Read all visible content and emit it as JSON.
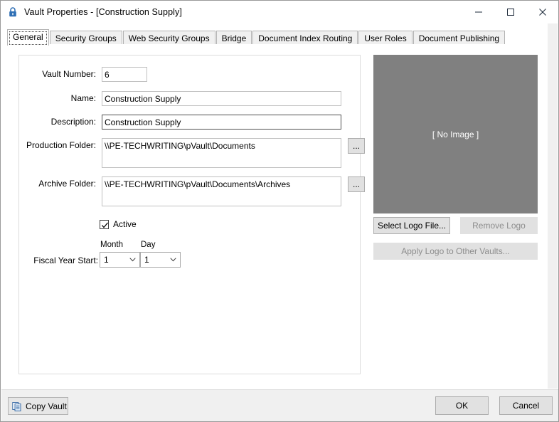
{
  "window": {
    "title": "Vault Properties - [Construction Supply]",
    "icon": "lock-icon",
    "controls": {
      "minimize": "minimize-icon",
      "maximize": "maximize-icon",
      "close": "close-icon"
    }
  },
  "tabs": [
    {
      "label": "General",
      "active": true
    },
    {
      "label": "Security Groups",
      "active": false
    },
    {
      "label": "Web Security Groups",
      "active": false
    },
    {
      "label": "Bridge",
      "active": false
    },
    {
      "label": "Document Index Routing",
      "active": false
    },
    {
      "label": "User Roles",
      "active": false
    },
    {
      "label": "Document Publishing",
      "active": false
    }
  ],
  "form": {
    "vault_number": {
      "label": "Vault Number:",
      "value": "6"
    },
    "name": {
      "label": "Name:",
      "value": "Construction Supply"
    },
    "description": {
      "label": "Description:",
      "value": "Construction Supply"
    },
    "production_folder": {
      "label": "Production Folder:",
      "value": "\\\\PE-TECHWRITING\\pVault\\Documents",
      "browse_label": "..."
    },
    "archive_folder": {
      "label": "Archive Folder:",
      "value": "\\\\PE-TECHWRITING\\pVault\\Documents\\Archives",
      "browse_label": "..."
    },
    "active": {
      "label": "Active",
      "checked": true
    },
    "fiscal_year_start": {
      "label": "Fiscal Year Start:",
      "month_caption": "Month",
      "month_value": "1",
      "day_caption": "Day",
      "day_value": "1"
    }
  },
  "logo": {
    "placeholder_text": "[ No Image ]",
    "placeholder_color": "#808080",
    "select_label": "Select Logo File...",
    "remove_label": "Remove Logo",
    "apply_label": "Apply Logo to Other Vaults..."
  },
  "footer": {
    "copy_vault_label": "Copy Vault",
    "ok_label": "OK",
    "cancel_label": "Cancel"
  }
}
